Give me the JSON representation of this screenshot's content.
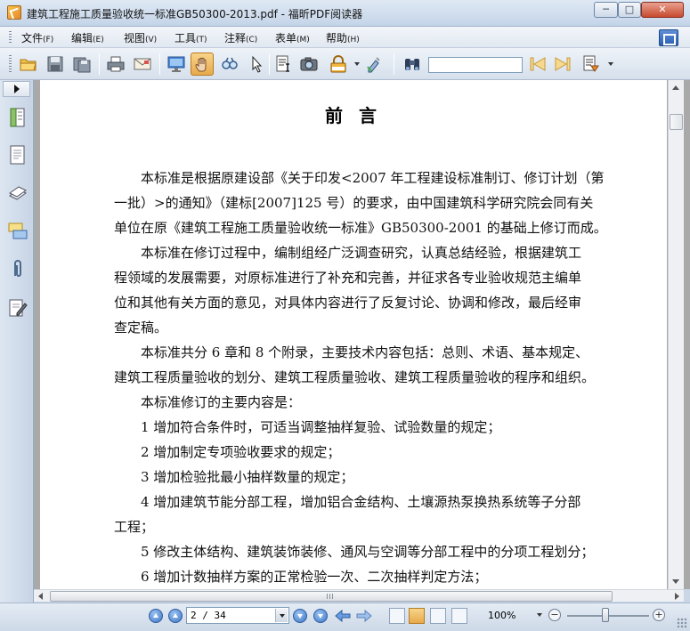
{
  "window": {
    "title": "建筑工程施工质量验收统一标准GB50300-2013.pdf - 福昕PDF阅读器",
    "min_label": "─",
    "max_label": "□",
    "close_label": "✕"
  },
  "menu": [
    {
      "label": "文件",
      "accel": "(F)"
    },
    {
      "label": "编辑",
      "accel": "(E)"
    },
    {
      "label": "视图",
      "accel": "(V)"
    },
    {
      "label": "工具",
      "accel": "(T)"
    },
    {
      "label": "注释",
      "accel": "(C)"
    },
    {
      "label": "表单",
      "accel": "(M)"
    },
    {
      "label": "帮助",
      "accel": "(H)"
    }
  ],
  "toolbar": {
    "search_value": "",
    "icons": [
      "open-folder-icon",
      "save-icon",
      "save-as-icon",
      "print-icon",
      "email-icon",
      "fullscreen-icon",
      "hand-tool-icon",
      "snapshot-zoom-icon",
      "select-arrow-icon",
      "text-select-icon",
      "camera-icon",
      "rms-icon",
      "sign-icon",
      "find-binoculars-icon",
      "prev-result-icon",
      "next-result-icon",
      "highlight-results-icon"
    ],
    "active_icon": "hand-tool-icon"
  },
  "document": {
    "title": "前言",
    "lines": [
      {
        "text": "本标准是根据原建设部《关于印发<2007 年工程建设标准制订、修订计划（第",
        "indent": true
      },
      {
        "text": "一批）>的通知》（建标[2007]125 号）的要求，由中国建筑科学研究院会同有关",
        "indent": false
      },
      {
        "text": "单位在原《建筑工程施工质量验收统一标准》GB50300-2001 的基础上修订而成。",
        "indent": false
      },
      {
        "text": "本标准在修订过程中，编制组经广泛调查研究，认真总结经验，根据建筑工",
        "indent": true
      },
      {
        "text": "程领域的发展需要，对原标准进行了补充和完善，并征求各专业验收规范主编单",
        "indent": false
      },
      {
        "text": "位和其他有关方面的意见，对具体内容进行了反复讨论、协调和修改，最后经审",
        "indent": false
      },
      {
        "text": "查定稿。",
        "indent": false
      },
      {
        "text": "本标准共分 6 章和 8 个附录，主要技术内容包括：总则、术语、基本规定、",
        "indent": true
      },
      {
        "text": "建筑工程质量验收的划分、建筑工程质量验收、建筑工程质量验收的程序和组织。",
        "indent": false
      },
      {
        "text": "本标准修订的主要内容是：",
        "indent": true
      },
      {
        "text": "1  增加符合条件时，可适当调整抽样复验、试验数量的规定；",
        "indent": true
      },
      {
        "text": "2  增加制定专项验收要求的规定；",
        "indent": true
      },
      {
        "text": "3  增加检验批最小抽样数量的规定；",
        "indent": true
      },
      {
        "text": "4  增加建筑节能分部工程，增加铝合金结构、土壤源热泵换热系统等子分部",
        "indent": true
      },
      {
        "text": "工程；",
        "indent": false
      },
      {
        "text": "5  修改主体结构、建筑装饰装修、通风与空调等分部工程中的分项工程划分；",
        "indent": true
      },
      {
        "text": "6  增加计数抽样方案的正常检验一次、二次抽样判定方法；",
        "indent": true
      }
    ]
  },
  "status": {
    "page_display": "2 / 34",
    "zoom": "100%",
    "zoom_minus": "−",
    "zoom_plus": "+"
  }
}
